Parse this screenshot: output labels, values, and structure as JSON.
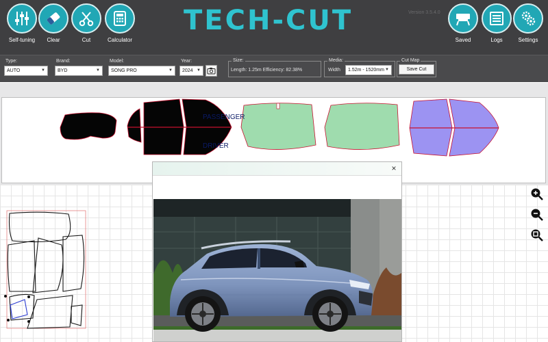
{
  "app": {
    "title": "TECH-CUT",
    "version": "Version 3.5.4.0"
  },
  "toolbar": {
    "left": [
      {
        "label": "Self-tuning",
        "icon": "sliders-icon"
      },
      {
        "label": "Clear",
        "icon": "eraser-icon"
      },
      {
        "label": "Cut",
        "icon": "scissors-icon"
      },
      {
        "label": "Calculator",
        "icon": "calculator-icon"
      }
    ],
    "right": [
      {
        "label": "Saved",
        "icon": "plotter-icon"
      },
      {
        "label": "Logs",
        "icon": "logs-icon"
      },
      {
        "label": "Settings",
        "icon": "gears-icon"
      }
    ]
  },
  "params": {
    "type": {
      "label": "Type:",
      "value": "AUTO"
    },
    "brand": {
      "label": "Brand:",
      "value": "BYD"
    },
    "model": {
      "label": "Model:",
      "value": "SONG PRO"
    },
    "year": {
      "label": "Year:",
      "value": "2024"
    },
    "size": {
      "label": "Size:",
      "value": "Length: 1.25m Efficiency: 82.38%"
    },
    "media": {
      "label": "Media:",
      "width_label": "Width",
      "value": "1.52m - 1520mm"
    },
    "cutmap": {
      "label": "Cut Map",
      "button": "Save Cut"
    }
  },
  "strip": {
    "passenger_label": "PASSENGER",
    "driver_label": "DRIVER"
  },
  "popup": {
    "close_symbol": "×"
  },
  "colors": {
    "toolbar_bg": "#3f3f41",
    "accent": "#21a7b5",
    "brand_text": "#2fc3cf",
    "tint_black": "#050505",
    "windshield_green": "#9fdcae",
    "sunroof_purple": "#9c93f2",
    "cut_red": "#c8102e"
  }
}
